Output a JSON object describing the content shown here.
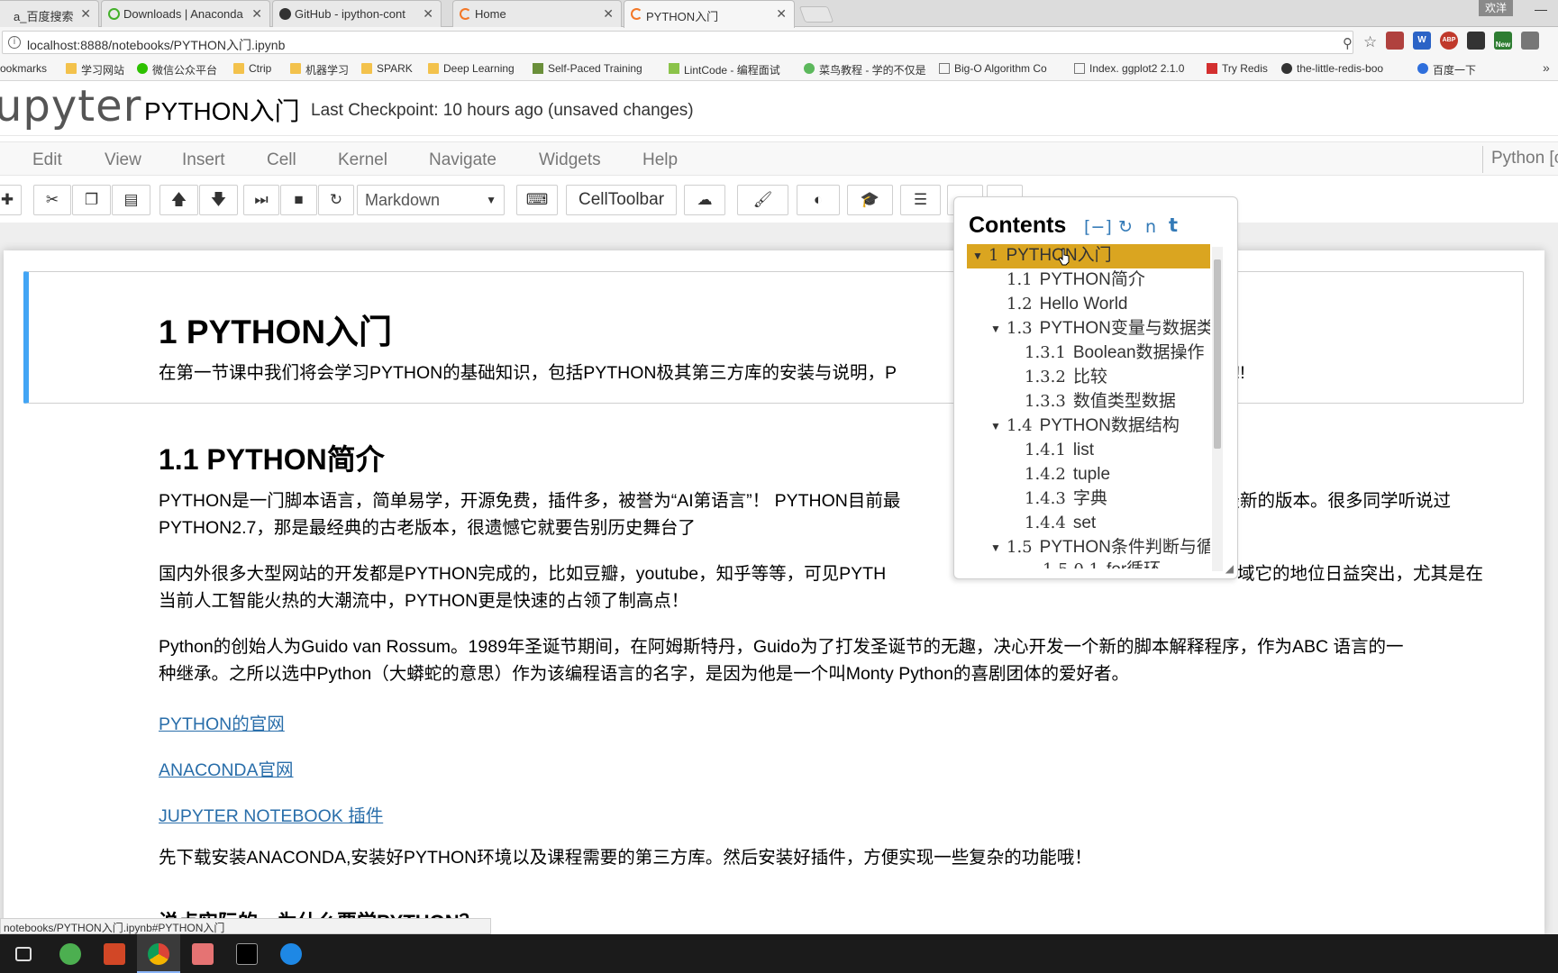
{
  "browser": {
    "tabs": [
      {
        "label": "a_百度搜索",
        "active": false
      },
      {
        "label": "Downloads | Anaconda",
        "active": false
      },
      {
        "label": "GitHub - ipython-cont",
        "active": false
      },
      {
        "label": "Home",
        "active": false
      },
      {
        "label": "PYTHON入门",
        "active": true
      }
    ],
    "user_badge": "欢洋",
    "url": "localhost:8888/notebooks/PYTHON入门.ipynb",
    "bookmarks": [
      "ookmarks",
      "学习网站",
      "微信公众平台",
      "Ctrip",
      "机器学习",
      "SPARK",
      "Deep Learning",
      "Self-Paced Training",
      "LintCode - 编程面试",
      "菜鸟教程 - 学的不仅是",
      "Big-O Algorithm Co",
      "Index. ggplot2 2.1.0",
      "Try Redis",
      "the-little-redis-boo",
      "百度一下"
    ],
    "extensions": [
      "W",
      "ABP",
      "New"
    ]
  },
  "notebook": {
    "logo": "upyter",
    "title": "PYTHON入门",
    "checkpoint": "Last Checkpoint: 10 hours ago (unsaved changes)",
    "menu": [
      "Edit",
      "View",
      "Insert",
      "Cell",
      "Kernel",
      "Navigate",
      "Widgets",
      "Help"
    ],
    "kernel": "Python [c",
    "cell_type": "Markdown",
    "celltoolbar_label": "CellToolbar"
  },
  "content": {
    "h1": "1  PYTHON入门",
    "intro": "在第一节课中我们将会学习PYTHON的基础知识，包括PYTHON极其第三方库的安装与说明，P",
    "intro_tail": "o!!",
    "h2": "1.1  PYTHON简介",
    "p1_line1a": "PYTHON是一门脚本语言，简单易学，开源免费，插件多，被誉为“AI第语言”！ PYTHON目前最",
    "p1_line1b": "用最新的版本。很多同学听说过",
    "p1_line2": "PYTHON2.7，那是最经典的古老版本，很遗憾它就要告别历史舞台了",
    "p2_line1a": "国内外很多大型网站的开发都是PYTHON完成的，比如豆瓣，youtube，知乎等等，可见PYTH",
    "p2_line1b": "域它的地位日益突出，尤其是在",
    "p2_line2": "当前人工智能火热的大潮流中，PYTHON更是快速的占领了制高点！",
    "p3_line1": "Python的创始人为Guido van Rossum。1989年圣诞节期间，在阿姆斯特丹，Guido为了打发圣诞节的无趣，决心开发一个新的脚本解释程序，作为ABC 语言的一",
    "p3_line2": "种继承。之所以选中Python（大蟒蛇的意思）作为该编程语言的名字，是因为他是一个叫Monty Python的喜剧团体的爱好者。",
    "link1": "PYTHON的官网",
    "link2": "ANACONDA官网",
    "link3": "JUPYTER NOTEBOOK 插件",
    "p4": "先下载安装ANACONDA,安装好PYTHON环境以及课程需要的第三方库。然后安装好插件，方便实现一些复杂的功能哦！",
    "h3_cut": "说点实际的，为什么要学PYTHON？"
  },
  "toc": {
    "title": "Contents",
    "controls": [
      "[−]",
      "↻",
      "n",
      "t"
    ],
    "items": [
      {
        "num": "1",
        "label": "PYTHON入门",
        "toggle": "▼",
        "highlight": true
      },
      {
        "num": "1.1",
        "label": "PYTHON简介",
        "toggle": ""
      },
      {
        "num": "1.2",
        "label": "Hello World",
        "toggle": ""
      },
      {
        "num": "1.3",
        "label": "PYTHON变量与数据类",
        "toggle": "▼"
      },
      {
        "num": "1.3.1",
        "label": "Boolean数据操作",
        "toggle": ""
      },
      {
        "num": "1.3.2",
        "label": "比较",
        "toggle": ""
      },
      {
        "num": "1.3.3",
        "label": "数值类型数据",
        "toggle": ""
      },
      {
        "num": "1.4",
        "label": "PYTHON数据结构",
        "toggle": "▼"
      },
      {
        "num": "1.4.1",
        "label": "list",
        "toggle": ""
      },
      {
        "num": "1.4.2",
        "label": "tuple",
        "toggle": ""
      },
      {
        "num": "1.4.3",
        "label": "字典",
        "toggle": ""
      },
      {
        "num": "1.4.4",
        "label": "set",
        "toggle": ""
      },
      {
        "num": "1.5",
        "label": "PYTHON条件判断与循",
        "toggle": "▼"
      },
      {
        "num": "1.5.0.1",
        "label": "for循环",
        "toggle": ""
      }
    ]
  },
  "status_url": "notebooks/PYTHON入门.ipynb#PYTHON入门",
  "colors": {
    "selected_cell_border": "#42a5f5",
    "toc_highlight": "#daa520",
    "link": "#296eaa"
  }
}
